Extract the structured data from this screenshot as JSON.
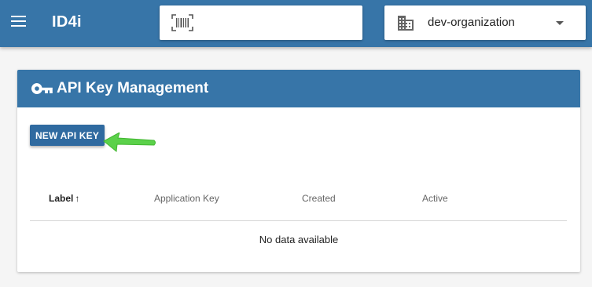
{
  "topbar": {
    "menu_icon": "hamburger-menu-icon",
    "title": "ID4i",
    "barcode_icon": "barcode-scan-icon",
    "barcode_value": "",
    "org_icon": "building-icon",
    "organization": "dev-organization",
    "colors": {
      "primary": "#3775a8"
    }
  },
  "card": {
    "icon": "key-icon",
    "title": "API Key Management",
    "new_button": "NEW API KEY",
    "annotation": "green-arrow",
    "table": {
      "columns": [
        "Label",
        "Application Key",
        "Created",
        "Active"
      ],
      "sort": {
        "column": "Label",
        "direction": "ascending",
        "icon": "↑"
      },
      "rows": [],
      "empty_text": "No data available"
    }
  }
}
